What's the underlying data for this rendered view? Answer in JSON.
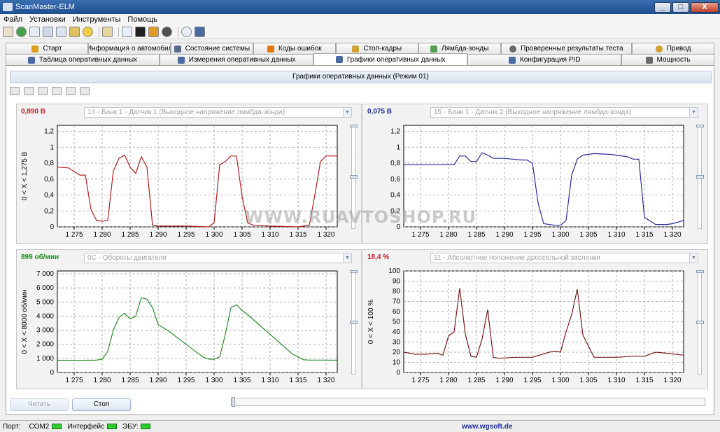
{
  "window": {
    "title": "ScanMaster-ELM",
    "min": "_",
    "max": "□",
    "close": "X"
  },
  "menu": [
    "Файл",
    "Установки",
    "Инструменты",
    "Помощь"
  ],
  "tabs_row1": [
    {
      "label": "Старт",
      "color": "#d9a020"
    },
    {
      "label": "Информация о автомобиле",
      "color": "#2a3a7a"
    },
    {
      "label": "Состояние системы",
      "color": "#5a6a8a"
    },
    {
      "label": "Коды ошибок",
      "color": "#e07a10"
    },
    {
      "label": "Стоп-кадры",
      "color": "#d0a030"
    },
    {
      "label": "Лямбда-зонды",
      "color": "#50a050"
    },
    {
      "label": "Проверенные результаты теста",
      "color": "#6a6a6a"
    },
    {
      "label": "Привод",
      "color": "#d0a030"
    }
  ],
  "tabs_row2": [
    {
      "label": "Таблица оперативных данных",
      "color": "#4a6aa0"
    },
    {
      "label": "Измерения оперативных данных",
      "color": "#4a6aa0"
    },
    {
      "label": "Графики оперативных данных",
      "color": "#4a6aa0",
      "active": true
    },
    {
      "label": "Конфигурация PID",
      "color": "#4a6aa0"
    },
    {
      "label": "Мощность",
      "color": "#6a6a6a"
    }
  ],
  "panel": {
    "title": "Графики оперативных данных (Режим 01)"
  },
  "charts": [
    {
      "value": "0,890 В",
      "value_color": "#c0202a",
      "pid": "14 - Банк 1 - Датчик 1 (Выходное напряжение лямбда-зонда)",
      "ylabel": "0 < X < 1,275 В",
      "line_color": "#b02020",
      "yticks": [
        "0",
        "0,2",
        "0,4",
        "0,6",
        "0,8",
        "1",
        "1,2"
      ],
      "ymax": 1.275,
      "xticks": [
        "1 275",
        "1 280",
        "1 285",
        "1 290",
        "1 295",
        "1 300",
        "1 305",
        "1 310",
        "1 315",
        "1 320"
      ]
    },
    {
      "value": "0,075 В",
      "value_color": "#1a2a8a",
      "pid": "15 - Банк 1 - Датчик 2 (Выходное напряжение лямбда-зонда)",
      "ylabel": "",
      "line_color": "#2a2a9a",
      "yticks": [
        "0",
        "0,2",
        "0,4",
        "0,6",
        "0,8",
        "1",
        "1,2"
      ],
      "ymax": 1.275,
      "xticks": [
        "1 275",
        "1 280",
        "1 285",
        "1 290",
        "1 295",
        "1 300",
        "1 305",
        "1 310",
        "1 315",
        "1 320"
      ]
    },
    {
      "value": "899 об/мин",
      "value_color": "#1f8a1f",
      "pid": "0C - Обороты двигателя",
      "ylabel": "0 < X < 8000 об/мин",
      "line_color": "#2a8a2a",
      "yticks": [
        "0",
        "1 000",
        "2 000",
        "3 000",
        "4 000",
        "5 000",
        "6 000",
        "7 000"
      ],
      "ymax": 7200,
      "xticks": [
        "1 275",
        "1 280",
        "1 285",
        "1 290",
        "1 295",
        "1 300",
        "1 305",
        "1 310",
        "1 315",
        "1 320"
      ]
    },
    {
      "value": "18,4 %",
      "value_color": "#c0202a",
      "pid": "11 - Абсолютное положение дроссельной заслонки",
      "ylabel": "0 < X < 100 %",
      "line_color": "#7a1a1a",
      "yticks": [
        "0",
        "10",
        "20",
        "30",
        "40",
        "50",
        "60",
        "70",
        "80",
        "90",
        "100"
      ],
      "ymax": 100,
      "xticks": [
        "1 275",
        "1 280",
        "1 285",
        "1 290",
        "1 295",
        "1 300",
        "1 305",
        "1 310",
        "1 315",
        "1 320"
      ]
    }
  ],
  "chart_data": [
    {
      "type": "line",
      "series": [
        {
          "name": "",
          "x": [
            1272,
            1274,
            1276,
            1277,
            1278,
            1279,
            1280,
            1281,
            1282,
            1283,
            1284,
            1285,
            1286,
            1287,
            1288,
            1289,
            1290,
            1295,
            1299,
            1300,
            1301,
            1302,
            1303,
            1304,
            1305,
            1306,
            1307,
            1310,
            1315,
            1317,
            1318,
            1319,
            1320,
            1321,
            1322
          ],
          "values": [
            0.75,
            0.74,
            0.65,
            0.65,
            0.22,
            0.08,
            0.07,
            0.08,
            0.7,
            0.86,
            0.9,
            0.75,
            0.67,
            0.88,
            0.75,
            0.02,
            0.01,
            0.01,
            0.0,
            0.05,
            0.78,
            0.82,
            0.89,
            0.89,
            0.38,
            0.05,
            0.02,
            0.01,
            0.0,
            0.02,
            0.4,
            0.82,
            0.89,
            0.89,
            0.89
          ]
        }
      ],
      "xlim": [
        1272,
        1322
      ],
      "ylim": [
        0,
        1.275
      ],
      "grid": true
    },
    {
      "type": "line",
      "series": [
        {
          "name": "",
          "x": [
            1272,
            1280,
            1281,
            1282,
            1283,
            1284,
            1285,
            1286,
            1287,
            1288,
            1290,
            1293,
            1294,
            1295,
            1296,
            1297,
            1299,
            1300,
            1301,
            1302,
            1303,
            1304,
            1306,
            1309,
            1312,
            1313,
            1314,
            1315,
            1317,
            1319,
            1320,
            1322
          ],
          "values": [
            0.78,
            0.78,
            0.78,
            0.89,
            0.89,
            0.82,
            0.82,
            0.93,
            0.9,
            0.86,
            0.86,
            0.84,
            0.84,
            0.8,
            0.3,
            0.04,
            0.02,
            0.02,
            0.08,
            0.65,
            0.85,
            0.9,
            0.92,
            0.91,
            0.88,
            0.85,
            0.85,
            0.12,
            0.03,
            0.03,
            0.04,
            0.08
          ]
        }
      ],
      "xlim": [
        1272,
        1322
      ],
      "ylim": [
        0,
        1.275
      ],
      "grid": true
    },
    {
      "type": "line",
      "series": [
        {
          "name": "",
          "x": [
            1272,
            1275,
            1278,
            1279,
            1280,
            1281,
            1282,
            1283,
            1284,
            1285,
            1286,
            1287,
            1288,
            1289,
            1290,
            1292,
            1294,
            1296,
            1298,
            1299,
            1300,
            1301,
            1302,
            1303,
            1304,
            1305,
            1306,
            1308,
            1310,
            1312,
            1314,
            1316,
            1317,
            1320,
            1322
          ],
          "values": [
            870,
            860,
            870,
            880,
            940,
            1500,
            3000,
            3900,
            4200,
            3800,
            4000,
            5300,
            5200,
            4600,
            3400,
            2900,
            2300,
            1700,
            1100,
            950,
            940,
            1100,
            2700,
            4600,
            4800,
            4400,
            4100,
            3400,
            2700,
            2000,
            1300,
            900,
            880,
            880,
            870
          ]
        }
      ],
      "xlim": [
        1272,
        1322
      ],
      "ylim": [
        0,
        7200
      ],
      "grid": true
    },
    {
      "type": "line",
      "series": [
        {
          "name": "",
          "x": [
            1272,
            1274,
            1276,
            1278,
            1279,
            1280,
            1281,
            1282,
            1283,
            1284,
            1285,
            1286,
            1287,
            1288,
            1289,
            1292,
            1295,
            1298,
            1299,
            1300,
            1301,
            1302,
            1303,
            1304,
            1306,
            1310,
            1313,
            1315,
            1317,
            1319,
            1322
          ],
          "values": [
            20,
            18,
            18,
            19,
            17,
            36,
            40,
            83,
            38,
            16,
            15,
            33,
            62,
            15,
            14,
            15,
            15,
            20,
            21,
            20,
            40,
            57,
            82,
            37,
            15,
            15,
            16,
            16,
            20,
            19,
            17
          ]
        }
      ],
      "xlim": [
        1272,
        1322
      ],
      "ylim": [
        0,
        100
      ],
      "grid": true
    }
  ],
  "buttons": {
    "read": "Читать",
    "stop": "Стоп"
  },
  "status": {
    "port_label": "Порт:",
    "port_value": "COM2",
    "interface": "Интерфейс",
    "ecu": "ЭБУ:",
    "url": "www.wgsoft.de"
  },
  "watermark": "WWW.RUAVTOSHOP.RU"
}
